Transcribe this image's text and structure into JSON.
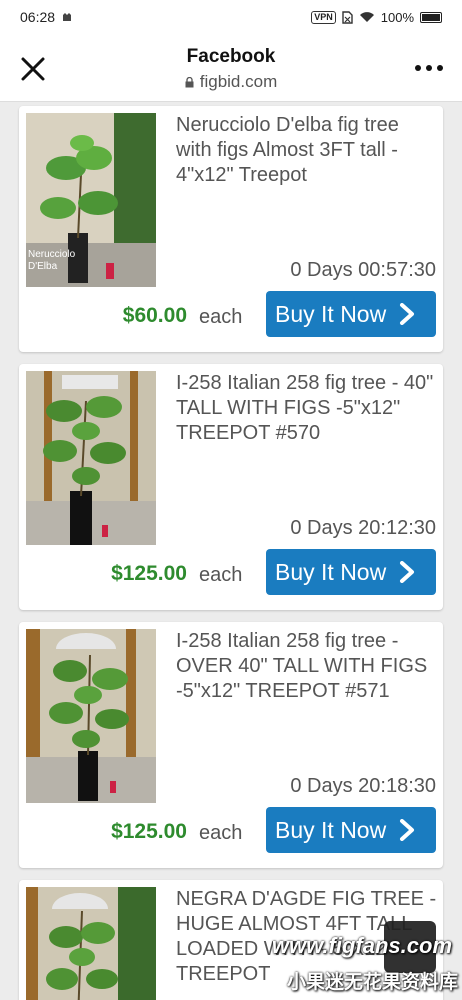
{
  "status_bar": {
    "time": "06:28",
    "vpn": "VPN",
    "battery": "100%"
  },
  "header": {
    "title": "Facebook",
    "url": "figbid.com"
  },
  "listings": [
    {
      "title": "Nerucciolo D'elba fig tree with figs Almost 3FT tall - 4\"x12\" Treepot",
      "photo_label": "Nerucciolo D'Elba",
      "time_left": "0 Days 00:57:30",
      "price": "$60.00",
      "unit": "each",
      "button": "Buy It Now"
    },
    {
      "title": "I-258 Italian 258 fig tree - 40\" TALL WITH FIGS -5\"x12\" TREEPOT #570",
      "time_left": "0 Days 20:12:30",
      "price": "$125.00",
      "unit": "each",
      "button": "Buy It Now"
    },
    {
      "title": "I-258 Italian 258 fig tree - OVER 40\" TALL WITH FIGS -5\"x12\" TREEPOT #571",
      "time_left": "0 Days 20:18:30",
      "price": "$125.00",
      "unit": "each",
      "button": "Buy It Now"
    },
    {
      "title": "NEGRA D'AGDE FIG TREE - HUGE ALMOST 4FT TALL LOADED WITH - 5\"X12\" TREEPOT"
    }
  ],
  "watermark": {
    "site": "www.figfans.com",
    "name": "小果迷无花果资料库"
  },
  "colors": {
    "price_green": "#2e8b2e",
    "button_blue": "#1a7cc0"
  }
}
